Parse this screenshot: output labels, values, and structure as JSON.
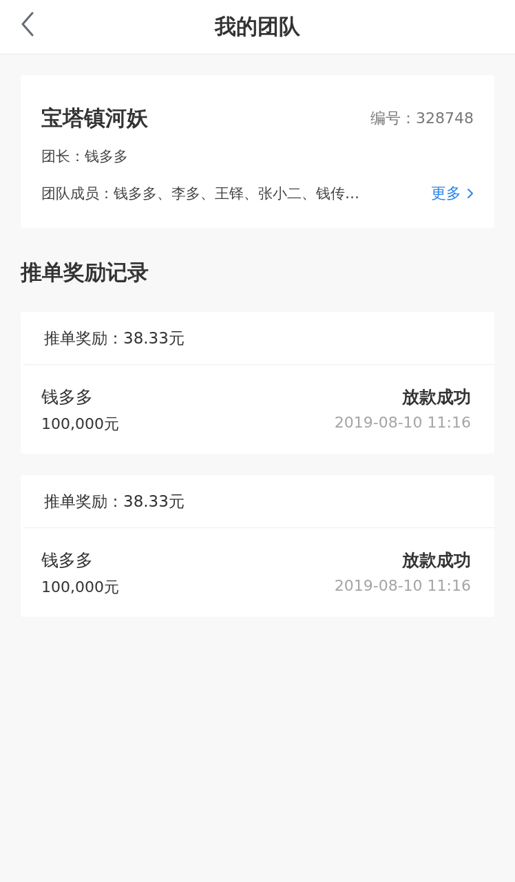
{
  "header": {
    "title": "我的团队"
  },
  "team": {
    "name": "宝塔镇河妖",
    "number_label": "编号：",
    "number": "328748",
    "leader_label": "团长：",
    "leader": "钱多多",
    "members_label": "团队成员：",
    "members": "钱多多、李多、王铎、张小二、钱传…",
    "more": "更多"
  },
  "section_title": "推单奖励记录",
  "records": [
    {
      "reward_label": "推单奖励：",
      "reward": "38.33元",
      "name": "钱多多",
      "amount": "100,000元",
      "status": "放款成功",
      "time": "2019-08-10 11:16"
    },
    {
      "reward_label": "推单奖励：",
      "reward": "38.33元",
      "name": "钱多多",
      "amount": "100,000元",
      "status": "放款成功",
      "time": "2019-08-10 11:16"
    }
  ]
}
